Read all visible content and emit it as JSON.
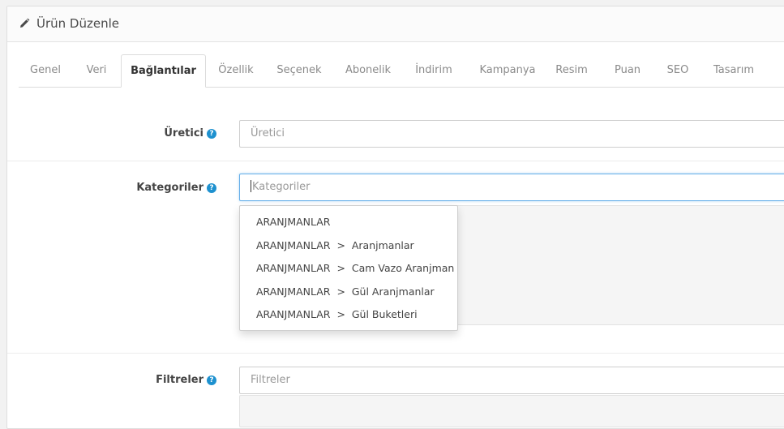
{
  "header": {
    "title": "Ürün Düzenle",
    "icon": "pencil-icon"
  },
  "tabs": [
    {
      "label": "Genel"
    },
    {
      "label": "Veri"
    },
    {
      "label": "Bağlantılar",
      "active": true
    },
    {
      "label": "Özellik"
    },
    {
      "label": "Seçenek"
    },
    {
      "label": "Abonelik"
    },
    {
      "label": "İndirim"
    },
    {
      "label": "Kampanya"
    },
    {
      "label": "Resim"
    },
    {
      "label": "Puan"
    },
    {
      "label": "SEO"
    },
    {
      "label": "Tasarım"
    }
  ],
  "form": {
    "manufacturer": {
      "label": "Üretici",
      "placeholder": "Üretici"
    },
    "categories": {
      "label": "Kategoriler",
      "placeholder": "Kategoriler"
    },
    "filters": {
      "label": "Filtreler",
      "placeholder": "Filtreler"
    }
  },
  "help_glyph": "?",
  "dropdown": {
    "items": [
      "ARANJMANLAR",
      "ARANJMANLAR  >  Aranjmanlar",
      "ARANJMANLAR  >  Cam Vazo Aranjman",
      "ARANJMANLAR  >  Gül Aranjmanlar",
      "ARANJMANLAR  >  Gül Buketleri"
    ]
  },
  "colors": {
    "accent": "#1e91cf",
    "focus_border": "#66afe9",
    "panel_bg": "#ffffff",
    "page_bg": "#f2f2f2"
  }
}
